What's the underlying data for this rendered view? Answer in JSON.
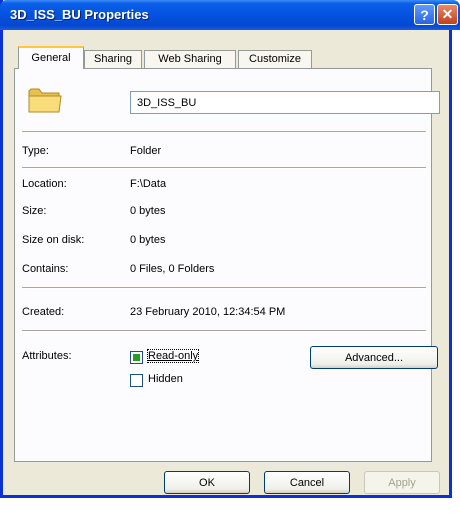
{
  "window": {
    "title": "3D_ISS_BU Properties"
  },
  "tabs": [
    {
      "label": "General"
    },
    {
      "label": "Sharing"
    },
    {
      "label": "Web Sharing"
    },
    {
      "label": "Customize"
    }
  ],
  "general": {
    "name_value": "3D_ISS_BU",
    "type_label": "Type:",
    "type_value": "Folder",
    "location_label": "Location:",
    "location_value": "F:\\Data",
    "size_label": "Size:",
    "size_value": "0 bytes",
    "size_on_disk_label": "Size on disk:",
    "size_on_disk_value": "0 bytes",
    "contains_label": "Contains:",
    "contains_value": "0 Files, 0 Folders",
    "created_label": "Created:",
    "created_value": "23 February 2010, 12:34:54 PM",
    "attributes_label": "Attributes:",
    "readonly_label": "Read-only",
    "readonly_state": "mixed",
    "hidden_label": "Hidden",
    "hidden_state": "unchecked",
    "advanced_label": "Advanced..."
  },
  "buttons": {
    "ok": "OK",
    "cancel": "Cancel",
    "apply": "Apply"
  },
  "icons": {
    "folder": "folder-icon",
    "help": "help-icon",
    "close": "close-icon"
  },
  "colors": {
    "titlebar": "#0452e0",
    "tab_highlight": "#ffc73c",
    "checkbox_mixed": "#21a121"
  }
}
